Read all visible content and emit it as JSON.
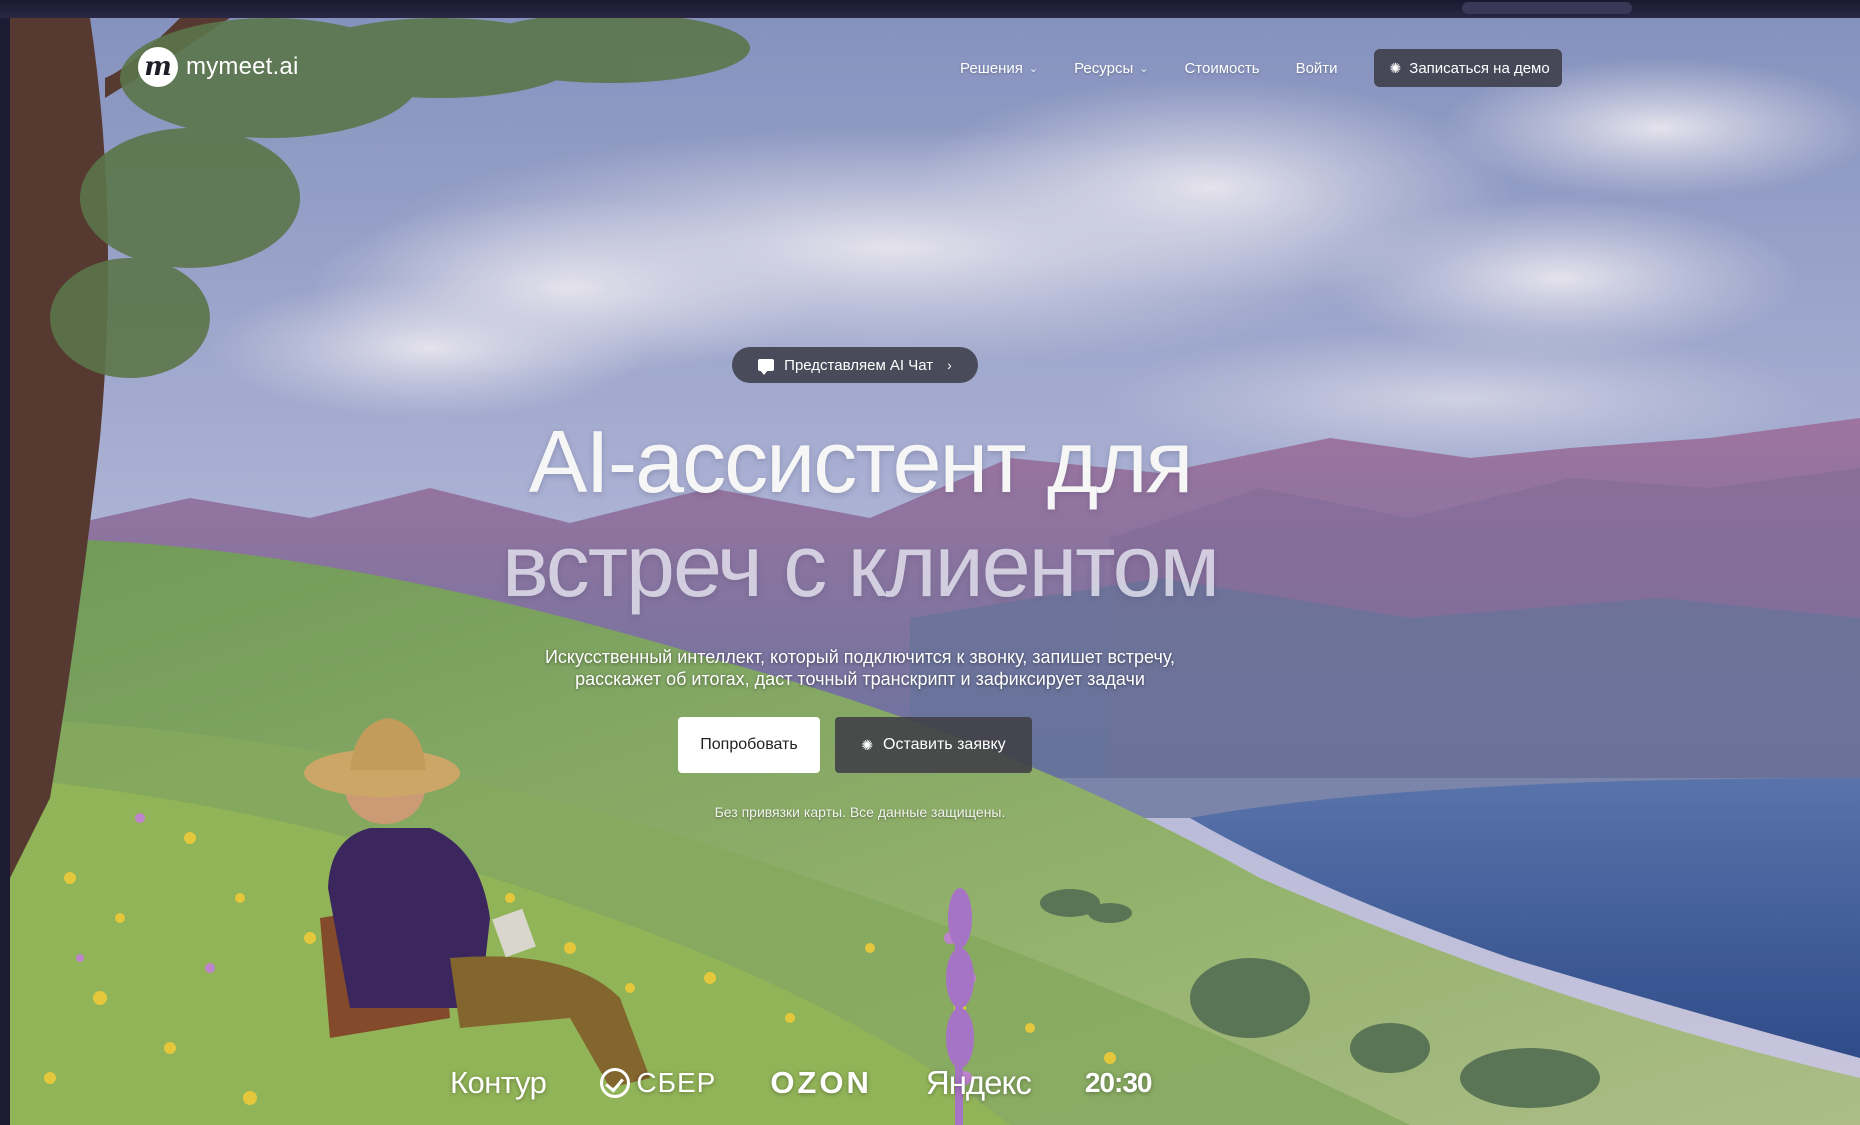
{
  "header": {
    "logo_text": "mymeet.ai",
    "nav": [
      {
        "label": "Решения",
        "has_dropdown": true
      },
      {
        "label": "Ресурсы",
        "has_dropdown": true
      },
      {
        "label": "Стоимость",
        "has_dropdown": false
      },
      {
        "label": "Войти",
        "has_dropdown": false
      }
    ],
    "demo_button": "Записаться на демо"
  },
  "hero": {
    "announcement": "Представляем AI Чат",
    "title_line1": "AI-ассистент для",
    "title_line2": "встреч с клиентом",
    "subtitle_line1": "Искусственный интеллект, который подключится к звонку, запишет встречу,",
    "subtitle_line2": "расскажет об итогах, даст точный транскрипт и зафиксирует задачи",
    "try_button": "Попробовать",
    "lead_button": "Оставить заявку",
    "note": "Без привязки карты. Все данные защищены."
  },
  "clients": [
    "Контур",
    "СБЕР",
    "OZON",
    "Яндекс",
    "20:30"
  ],
  "icons": {
    "logo": "mymeet-logo-icon",
    "dropdown": "chevron-down-icon",
    "spark": "sparkle-icon",
    "chat": "chat-bubble-icon",
    "arrow": "chevron-right-icon"
  },
  "colors": {
    "primary_button_bg": "#ffffff",
    "dark_button_bg": "#404046",
    "text": "#ffffff"
  }
}
